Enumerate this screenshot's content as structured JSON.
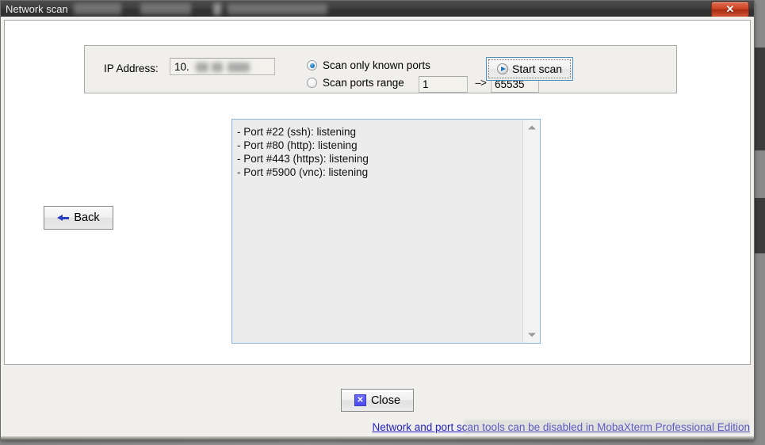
{
  "window": {
    "title": "Network scan",
    "close_button_glyph": "✕",
    "redacted_titlebar_note": ""
  },
  "settings": {
    "ip_label": "IP Address:",
    "ip_value": "10.",
    "ip_placeholder": "IP Address",
    "scan_mode": {
      "known_ports_label": "Scan only known ports",
      "known_ports_selected": true,
      "range_label": "Scan ports range",
      "range_selected": false,
      "range_from": "1",
      "range_to": "65535",
      "range_arrow": "-->"
    },
    "start_scan_label": "Start scan",
    "start_scan_icon": "play-circle-icon"
  },
  "results": {
    "lines": [
      "- Port #22 (ssh):  listening",
      "- Port #80 (http):  listening",
      "- Port #443 (https):  listening",
      "- Port #5900 (vnc):  listening"
    ],
    "scrollbar": {
      "up_icon": "chevron-up-icon",
      "down_icon": "chevron-down-icon"
    }
  },
  "actions": {
    "back_label": "Back",
    "back_icon": "arrow-left-icon",
    "close_label": "Close",
    "close_icon": "x-square-icon"
  },
  "footer": {
    "promo_link": "Network and port scan tools can be disabled in MobaXterm Professional Edition"
  },
  "colors": {
    "accent_blue": "#2020c0",
    "button_focus_border": "#4a8fc4",
    "titlebar": "#3a3a3a",
    "close_red": "#cf4423",
    "panel_bg": "#f0efeb",
    "list_bg": "#ececec"
  }
}
